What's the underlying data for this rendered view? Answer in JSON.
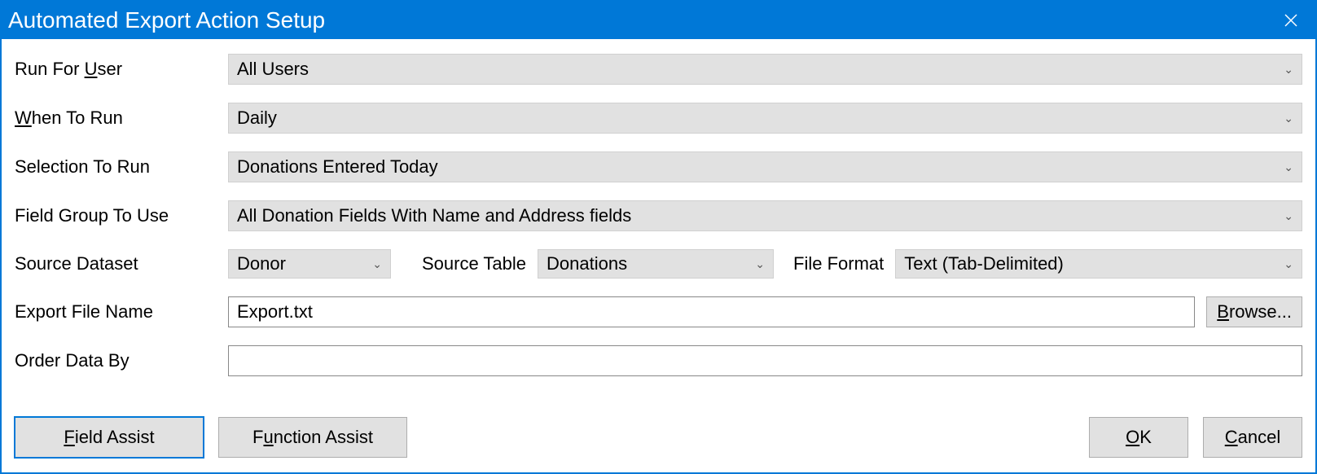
{
  "window": {
    "title": "Automated Export Action Setup"
  },
  "labels": {
    "run_for_user_pre": "Run For ",
    "run_for_user_u": "U",
    "run_for_user_post": "ser",
    "when_to_run_u": "W",
    "when_to_run_post": "hen To Run",
    "selection_to_run": "Selection To Run",
    "field_group_to_use": "Field Group To Use",
    "source_dataset": "Source Dataset",
    "source_table": "Source Table",
    "file_format": "File Format",
    "export_file_name": "Export File Name",
    "order_data_by": "Order Data By"
  },
  "fields": {
    "run_for_user": "All Users",
    "when_to_run": "Daily",
    "selection_to_run": "Donations Entered Today",
    "field_group_to_use": "All Donation Fields With Name and Address fields",
    "source_dataset": "Donor",
    "source_table": "Donations",
    "file_format": "Text (Tab-Delimited)",
    "export_file_name": "Export.txt",
    "order_data_by": ""
  },
  "buttons": {
    "browse_u": "B",
    "browse_post": "rowse...",
    "field_assist_u": "F",
    "field_assist_post": "ield Assist",
    "function_assist_pre": "F",
    "function_assist_u": "u",
    "function_assist_post": "nction Assist",
    "ok_u": "O",
    "ok_post": "K",
    "cancel_u": "C",
    "cancel_post": "ancel"
  }
}
